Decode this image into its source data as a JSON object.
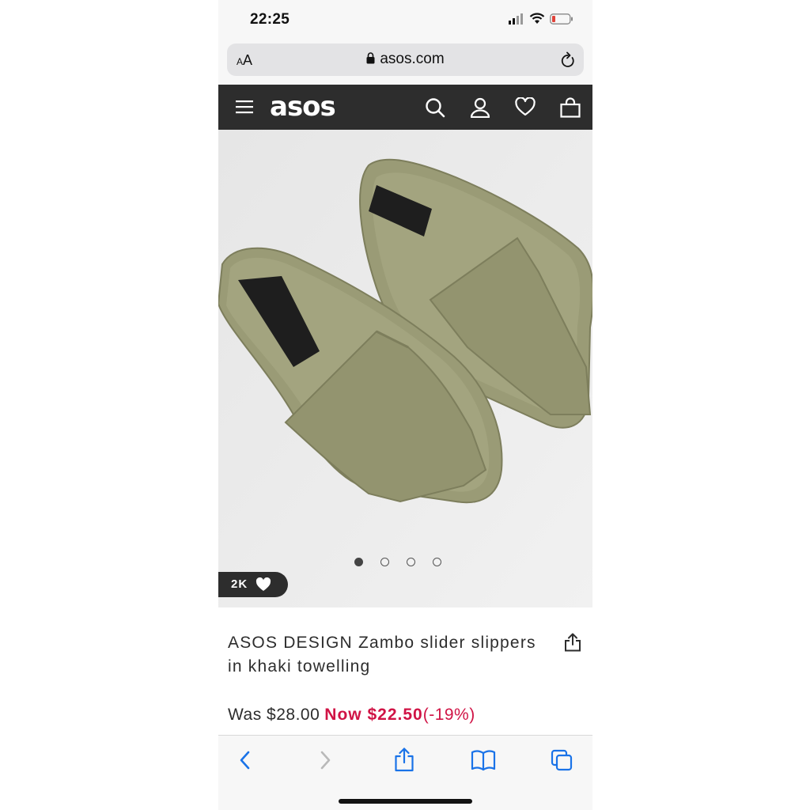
{
  "status_bar": {
    "time": "22:25"
  },
  "url_bar": {
    "aa_small": "A",
    "aa_large": "A",
    "domain": "asos.com"
  },
  "header": {
    "logo": "asos",
    "icons": [
      "menu-icon",
      "search-icon",
      "account-icon",
      "heart-icon",
      "bag-icon"
    ]
  },
  "gallery": {
    "image_count": 4,
    "active_index": 0,
    "likes": "2K"
  },
  "product": {
    "title": "ASOS DESIGN Zambo slider slippers in khaki towelling",
    "was_price": "Was $28.00",
    "now_price": "Now $22.50",
    "discount": "(-19%)"
  },
  "toolbar": {
    "icons": [
      "back-icon",
      "forward-icon",
      "share-icon",
      "bookmarks-icon",
      "tabs-icon"
    ]
  },
  "colors": {
    "header_bg": "#2d2d2d",
    "sale": "#d01345",
    "ios_blue": "#1a73e8",
    "khaki": "#9a9b76"
  }
}
